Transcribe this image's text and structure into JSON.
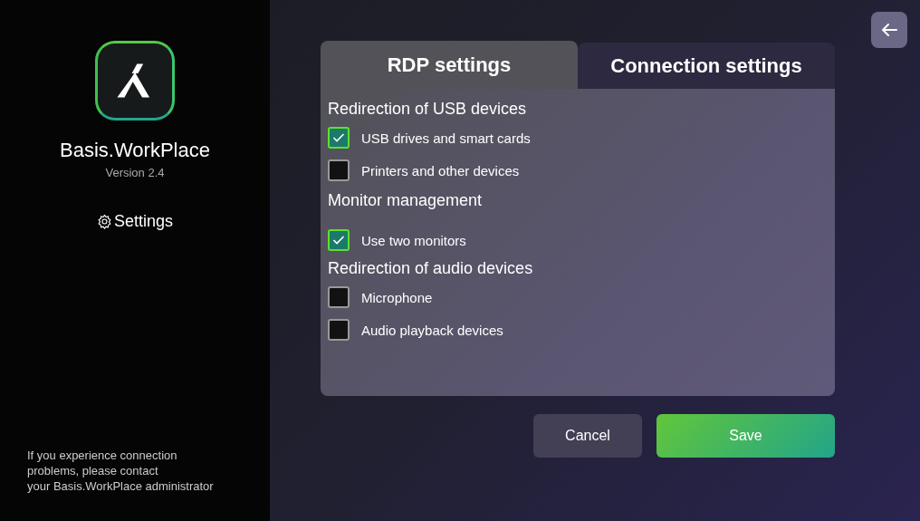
{
  "sidebar": {
    "app_name": "Basis.WorkPlace",
    "version": "Version 2.4",
    "nav_item": "Settings",
    "footer_note": "If you experience connection\nproblems, please contact\nyour Basis.WorkPlace administrator"
  },
  "tabs": [
    {
      "label": "RDP settings",
      "selected": true
    },
    {
      "label": "Connection settings",
      "selected": false
    }
  ],
  "sections": [
    {
      "title": "Redirection of USB devices",
      "items": [
        {
          "label": "USB drives and smart cards",
          "checked": true
        },
        {
          "label": "Printers and other devices",
          "checked": false
        }
      ]
    },
    {
      "title": "Monitor management",
      "items": [
        {
          "label": "Use two monitors",
          "checked": true
        }
      ]
    },
    {
      "title": "Redirection of audio devices",
      "items": [
        {
          "label": "Microphone",
          "checked": false
        },
        {
          "label": "Audio playback devices",
          "checked": false
        }
      ]
    }
  ],
  "buttons": {
    "cancel": "Cancel",
    "save": "Save"
  }
}
